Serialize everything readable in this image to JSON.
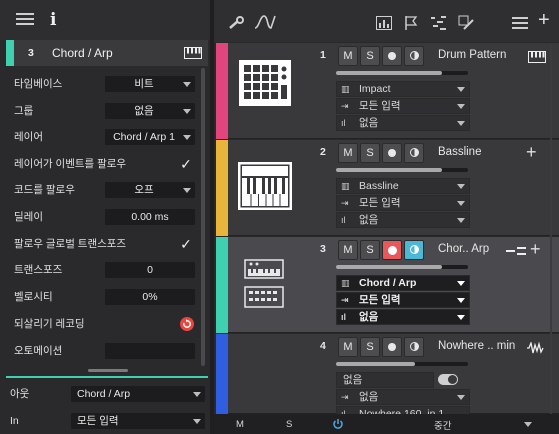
{
  "inspector": {
    "track_number": "3",
    "track_name": "Chord / Arp",
    "accent_color": "#3fd0b0",
    "rows": [
      {
        "label": "타임베이스",
        "value": "비트",
        "kind": "dropdown"
      },
      {
        "label": "그룹",
        "value": "없음",
        "kind": "dropdown"
      },
      {
        "label": "레이어",
        "value": "Chord / Arp 1",
        "kind": "dropdown"
      },
      {
        "label": "레이어가 이벤트를 팔로우",
        "value": "✓",
        "kind": "check"
      },
      {
        "label": "코드를 팔로우",
        "value": "오프",
        "kind": "dropdown"
      },
      {
        "label": "딜레이",
        "value": "0.00 ms",
        "kind": "box"
      },
      {
        "label": "팔로우 글로벌 트랜스포즈",
        "value": "✓",
        "kind": "check"
      },
      {
        "label": "트랜스포즈",
        "value": "0",
        "kind": "box"
      },
      {
        "label": "벨로시티",
        "value": "0%",
        "kind": "box"
      },
      {
        "label": "되살리기 레코딩",
        "value": "",
        "kind": "icon"
      },
      {
        "label": "오토메이션",
        "value": "",
        "kind": "box"
      }
    ],
    "out_label": "아웃",
    "out_value": "Chord / Arp",
    "in_label": "In",
    "in_value": "모든 입력"
  },
  "toolbar": {
    "icons": [
      "wrench-icon",
      "curve-icon",
      "grid-icon",
      "flag-icon",
      "notes-icon",
      "pencil-icon",
      "list-icon",
      "add-icon"
    ]
  },
  "tracks": [
    {
      "number": "1",
      "name": "Drum Pattern",
      "color": "#e0457d",
      "output": "Impact",
      "input": "모든 입력",
      "layer": "없음",
      "volume": 0.8,
      "selected": false,
      "record": false,
      "name_icon": "piano-icon",
      "device": "drum-machine-icon"
    },
    {
      "number": "2",
      "name": "Bassline",
      "color": "#e8b53a",
      "output": "Bassline",
      "input": "모든 입력",
      "layer": "없음",
      "volume": 0.8,
      "selected": false,
      "record": false,
      "name_icon": "add-icon",
      "device": "synth-keyboard-icon"
    },
    {
      "number": "3",
      "name": "Chor.. Arp",
      "color": "#3fd0b0",
      "output": "Chord / Arp",
      "input": "모든 입력",
      "layer": "없음",
      "volume": 0.8,
      "selected": true,
      "record": true,
      "name_icon": "chord-icon",
      "device": "arp-synth-icon"
    },
    {
      "number": "4",
      "name": "Nowhere .. min",
      "color": "#2f5fe0",
      "output": "없음",
      "input": "없음",
      "layer": "Nowhere 160_in 1",
      "volume": 0.6,
      "selected": false,
      "record": false,
      "name_icon": "waveform-icon",
      "device": "audio-icon"
    }
  ],
  "buttons": {
    "mute": "M",
    "solo": "S"
  },
  "bottom": {
    "m": "M",
    "s": "S",
    "mode": "중간"
  }
}
